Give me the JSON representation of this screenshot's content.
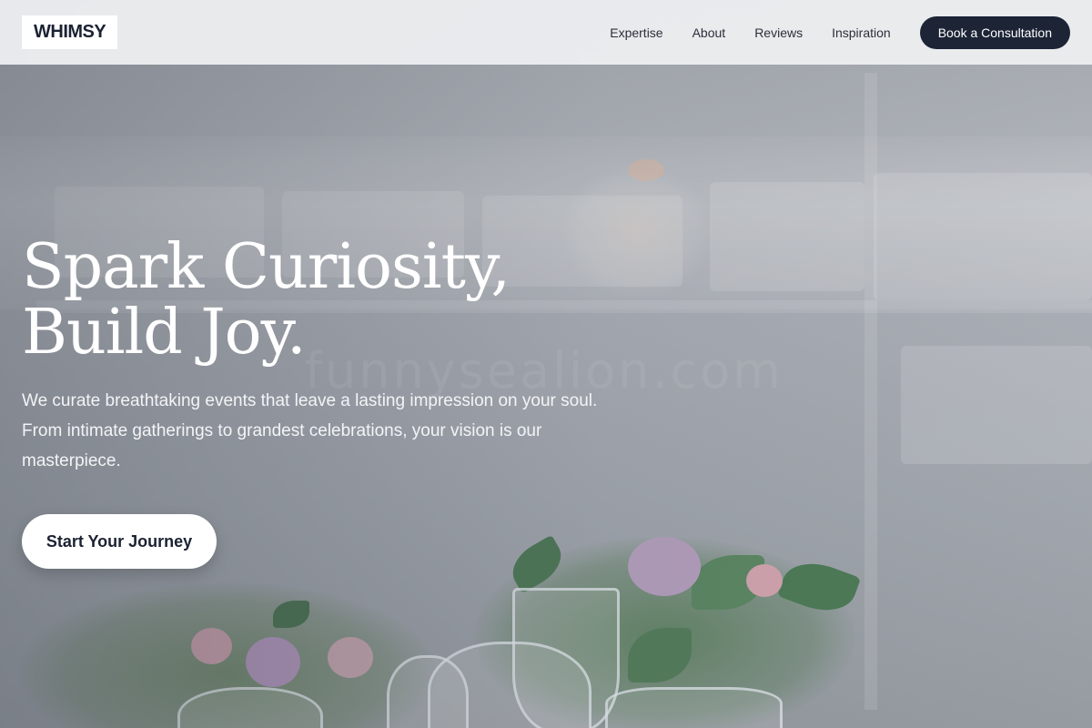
{
  "brand": {
    "logo_text": "WHIMSY"
  },
  "nav": {
    "links": [
      "Expertise",
      "About",
      "Reviews",
      "Inspiration"
    ],
    "cta_label": "Book a Consultation"
  },
  "hero": {
    "headline_line1": "Spark Curiosity,",
    "headline_line2": "Build Joy.",
    "description": "We curate breathtaking events that leave a lasting impression on your soul. From intimate gatherings to grandest celebrations, your vision is our masterpiece.",
    "button_label": "Start Your Journey",
    "watermark": "funnysealion.com"
  },
  "colors": {
    "primary_dark": "#1c2436",
    "nav_background": "#ecedef",
    "button_background": "#ffffff"
  },
  "icons": []
}
